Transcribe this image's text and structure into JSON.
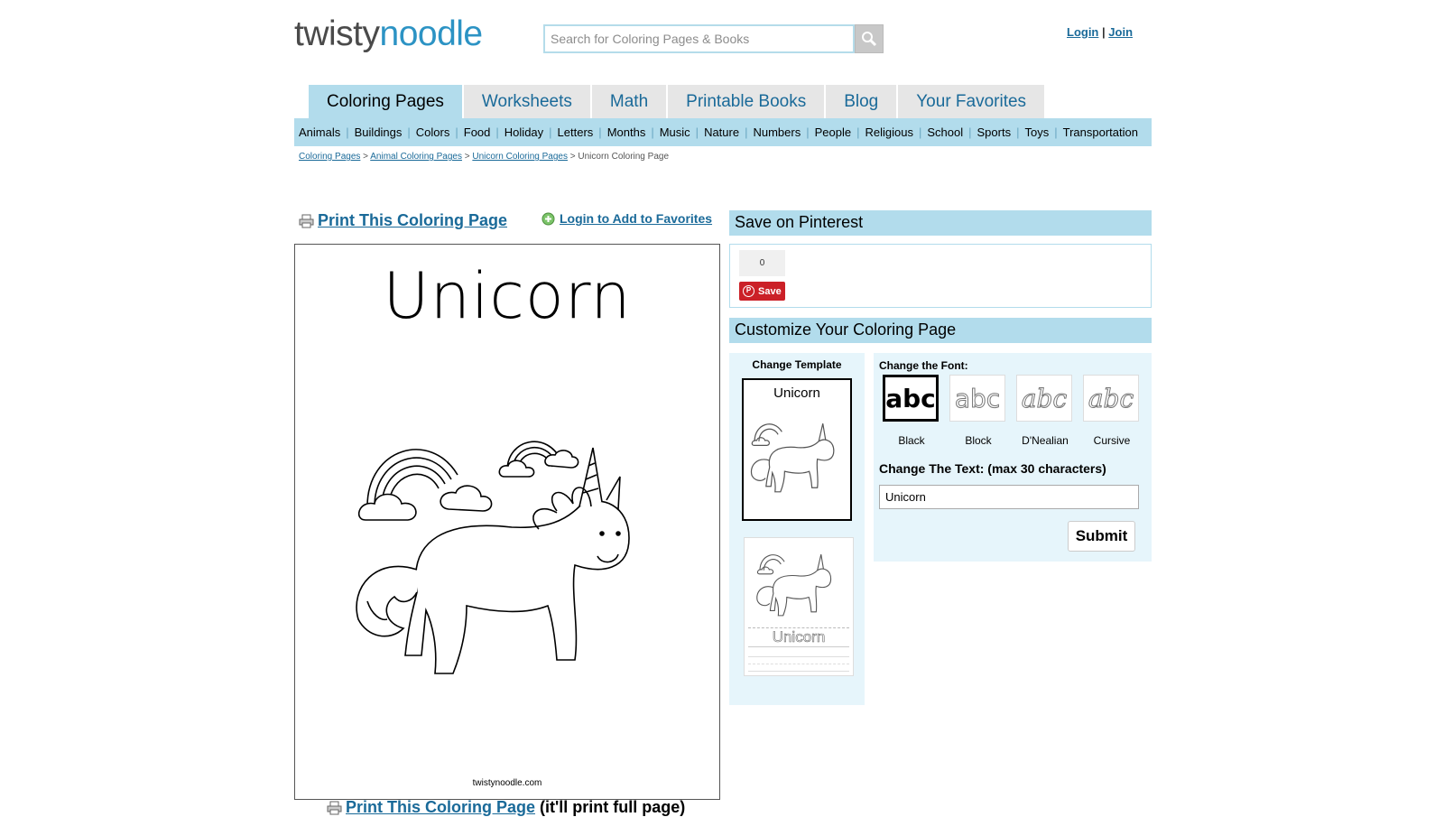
{
  "header": {
    "logo_part1": "twisty",
    "logo_part2": "noodle",
    "search_placeholder": "Search for Coloring Pages & Books",
    "login": "Login",
    "separator": "|",
    "join": "Join"
  },
  "nav": {
    "tabs": [
      "Coloring Pages",
      "Worksheets",
      "Math",
      "Printable Books",
      "Blog",
      "Your Favorites"
    ],
    "active_tab": "Coloring Pages",
    "categories": [
      "Animals",
      "Buildings",
      "Colors",
      "Food",
      "Holiday",
      "Letters",
      "Months",
      "Music",
      "Nature",
      "Numbers",
      "People",
      "Religious",
      "School",
      "Sports",
      "Toys",
      "Transportation"
    ]
  },
  "breadcrumb": {
    "items": [
      "Coloring Pages",
      "Animal Coloring Pages",
      "Unicorn Coloring Pages"
    ],
    "current": "Unicorn Coloring Page",
    "separator": ">"
  },
  "main": {
    "print_label": "Print This Coloring Page",
    "favorites_label": "Login to Add to Favorites",
    "sheet_title": "Unicorn",
    "sheet_footer": "twistynoodle.com",
    "print_note": "(it'll print full page)"
  },
  "pinterest": {
    "heading": "Save on Pinterest",
    "count": "0",
    "save_label": "Save"
  },
  "customize": {
    "heading": "Customize Your Coloring Page",
    "change_template": "Change Template",
    "template_title": "Unicorn",
    "change_font": "Change the Font:",
    "fonts": [
      {
        "name": "Black",
        "sample": "abc"
      },
      {
        "name": "Block",
        "sample": "abc"
      },
      {
        "name": "D'Nealian",
        "sample": "abc"
      },
      {
        "name": "Cursive",
        "sample": "abc"
      }
    ],
    "change_text": "Change The Text: (max 30 characters)",
    "text_value": "Unicorn",
    "submit": "Submit"
  },
  "colors": {
    "accent_blue": "#b2dcec",
    "link_blue": "#1a6a99",
    "logo_blue": "#2c93c4",
    "pinterest_red": "#cb2027"
  }
}
